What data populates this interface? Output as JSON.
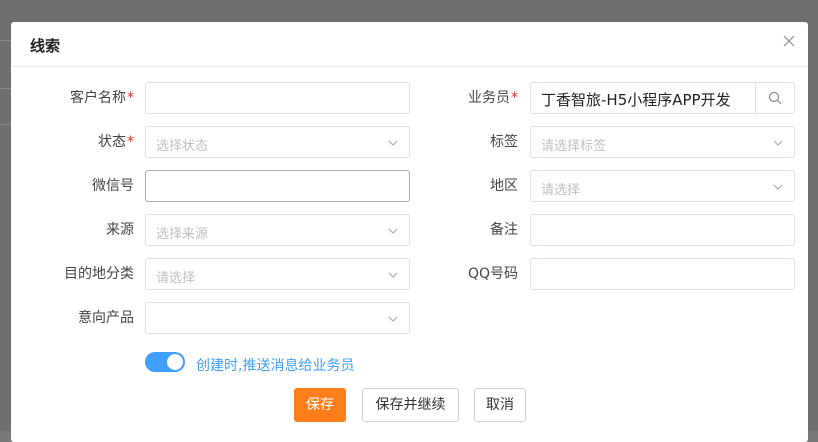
{
  "modal": {
    "title": "线索",
    "close_icon": "close-icon"
  },
  "form": {
    "customer_name": {
      "label": "客户名称",
      "required": "*",
      "value": ""
    },
    "salesperson": {
      "label": "业务员",
      "required": "*",
      "value": "丁香智旅-H5小程序APP开发"
    },
    "status": {
      "label": "状态",
      "required": "*",
      "placeholder": "选择状态"
    },
    "tags": {
      "label": "标签",
      "placeholder": "请选择标签"
    },
    "wechat": {
      "label": "微信号",
      "value": ""
    },
    "region": {
      "label": "地区",
      "placeholder": "请选择"
    },
    "source": {
      "label": "来源",
      "placeholder": "选择来源"
    },
    "remark": {
      "label": "备注",
      "value": ""
    },
    "destination_category": {
      "label": "目的地分类",
      "placeholder": "请选择"
    },
    "qq": {
      "label": "QQ号码",
      "value": ""
    },
    "intended_product": {
      "label": "意向产品",
      "placeholder": ""
    }
  },
  "notify_toggle": {
    "label": "创建时,推送消息给业务员",
    "on": true
  },
  "buttons": {
    "save": "保存",
    "save_continue": "保存并继续",
    "cancel": "取消"
  },
  "colors": {
    "primary_button": "#ff7e1c",
    "toggle_on": "#409eff",
    "required": "#e0312b"
  }
}
